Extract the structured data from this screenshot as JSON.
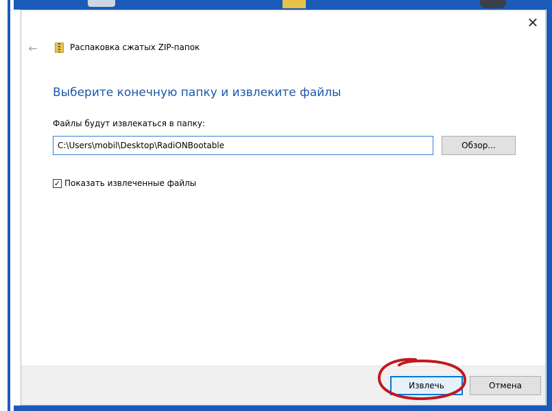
{
  "dialog": {
    "title": "Распаковка сжатых ZIP-папок",
    "close_icon": "close-icon",
    "back_icon": "back-arrow-icon",
    "folder_icon": "zip-folder-icon"
  },
  "main": {
    "heading": "Выберите конечную папку и извлеките файлы",
    "path_label": "Файлы будут извлекаться в папку:",
    "path_value": "C:\\Users\\mobil\\Desktop\\RadiONBootable",
    "browse_label": "Обзор...",
    "show_files_label": "Показать извлеченные файлы",
    "show_files_checked": true
  },
  "footer": {
    "extract_label": "Извлечь",
    "cancel_label": "Отмена"
  },
  "colors": {
    "heading": "#1a57a8",
    "accent": "#0078d7",
    "desktop": "#1a5bb8",
    "annotation": "#c0191f"
  }
}
